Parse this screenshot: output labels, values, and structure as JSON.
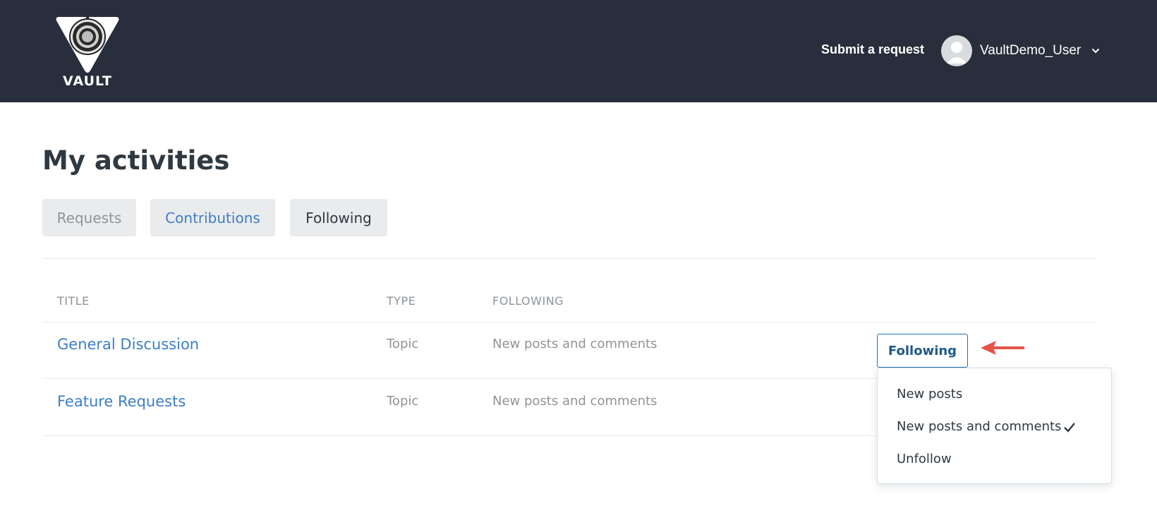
{
  "header": {
    "logo_text": "VAULT",
    "submit_request": "Submit a request",
    "username": "VaultDemo_User",
    "icons": {
      "user": "avatar-icon",
      "dropdown": "chevron-down-icon"
    }
  },
  "page": {
    "title": "My activities",
    "tabs": [
      {
        "label": "Requests",
        "state": "inactive"
      },
      {
        "label": "Contributions",
        "state": "link"
      },
      {
        "label": "Following",
        "state": "active"
      }
    ]
  },
  "table": {
    "columns": [
      "TITLE",
      "TYPE",
      "FOLLOWING"
    ],
    "rows": [
      {
        "title": "General Discussion",
        "type": "Topic",
        "following": "New posts and comments"
      },
      {
        "title": "Feature Requests",
        "type": "Topic",
        "following": "New posts and comments"
      }
    ]
  },
  "follow_button": {
    "label": "Following"
  },
  "dropdown": {
    "items": [
      {
        "label": "New posts",
        "selected": false
      },
      {
        "label": "New posts and comments",
        "selected": true
      },
      {
        "label": "Unfollow",
        "selected": false
      }
    ]
  },
  "colors": {
    "header_bg": "#282e3b",
    "link": "#3d7ec5",
    "muted": "#8f9499",
    "tab_bg": "#eaebed",
    "button_border": "#1f73b7",
    "annotation_arrow": "#e5534b"
  }
}
